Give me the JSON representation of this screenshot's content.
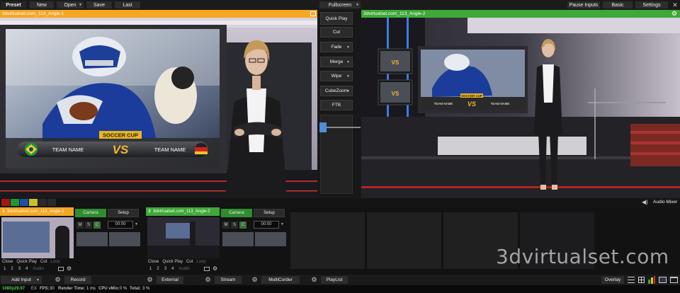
{
  "toolbar": {
    "preset": "Preset",
    "new": "New",
    "open": "Open",
    "save": "Save",
    "last": "Last",
    "fullscreen": "Fullscreen",
    "pause_inputs": "Pause Inputs",
    "basic": "Basic",
    "settings": "Settings"
  },
  "preview": {
    "title": "3dvirtualset.com_113_Angle-1",
    "accent": "#f5a623"
  },
  "output": {
    "title": "3dvirtualset.com_113_Angle-2",
    "accent": "#3fa838"
  },
  "graphics": {
    "banner": "SOCCER CUP",
    "team_left": "TEAM NAME",
    "vs": "VS",
    "team_right": "TEAM NAME"
  },
  "transitions": {
    "quick_play": "Quick Play",
    "cut": "Cut",
    "fade": "Fade",
    "merge": "Merge",
    "wipe": "Wipe",
    "cubezoom": "CubeZoom",
    "ftb": "FTB"
  },
  "colors": [
    "#a21717",
    "#1f9a2f",
    "#1b4fa8",
    "#c7c22a",
    "#2a2a2a",
    "#2a2a2a"
  ],
  "audio_mixer": "Audio Mixer",
  "inputs": [
    {
      "number": "1",
      "name": "3dvirtualset.com_113_Angle-1",
      "camera": "Camera",
      "setup": "Setup",
      "time": "00:00",
      "controls": [
        "Close",
        "Quick Play",
        "Cut",
        "Loop"
      ],
      "numbers": [
        "1",
        "2",
        "3",
        "4"
      ],
      "audio": "Audio",
      "mix": [
        "M",
        "S",
        "C"
      ]
    },
    {
      "number": "2",
      "name": "3dvirtualset.com_113_Angle-2",
      "camera": "Camera",
      "setup": "Setup",
      "time": "00:00",
      "controls": [
        "Close",
        "Quick Play",
        "Cut",
        "Loop"
      ],
      "numbers": [
        "1",
        "2",
        "3",
        "4"
      ],
      "audio": "Audio",
      "mix": [
        "M",
        "S",
        "C"
      ]
    }
  ],
  "watermark": "3dvirtualset.com",
  "bottom": {
    "add_input": "Add Input",
    "record": "Record",
    "external": "External",
    "stream": "Stream",
    "multicorder": "MultiCorder",
    "playlist": "PlayList",
    "overlay": "Overlay"
  },
  "status": {
    "format": "1080p29.97",
    "ex_label": "EX",
    "fps_label": "FPS:",
    "fps": "30",
    "render_label": "Render Time:",
    "render": "1 ms",
    "cpu_label": "CPU vMix:",
    "cpu": "0 %",
    "total_label": "Total:",
    "total": "3 %"
  }
}
